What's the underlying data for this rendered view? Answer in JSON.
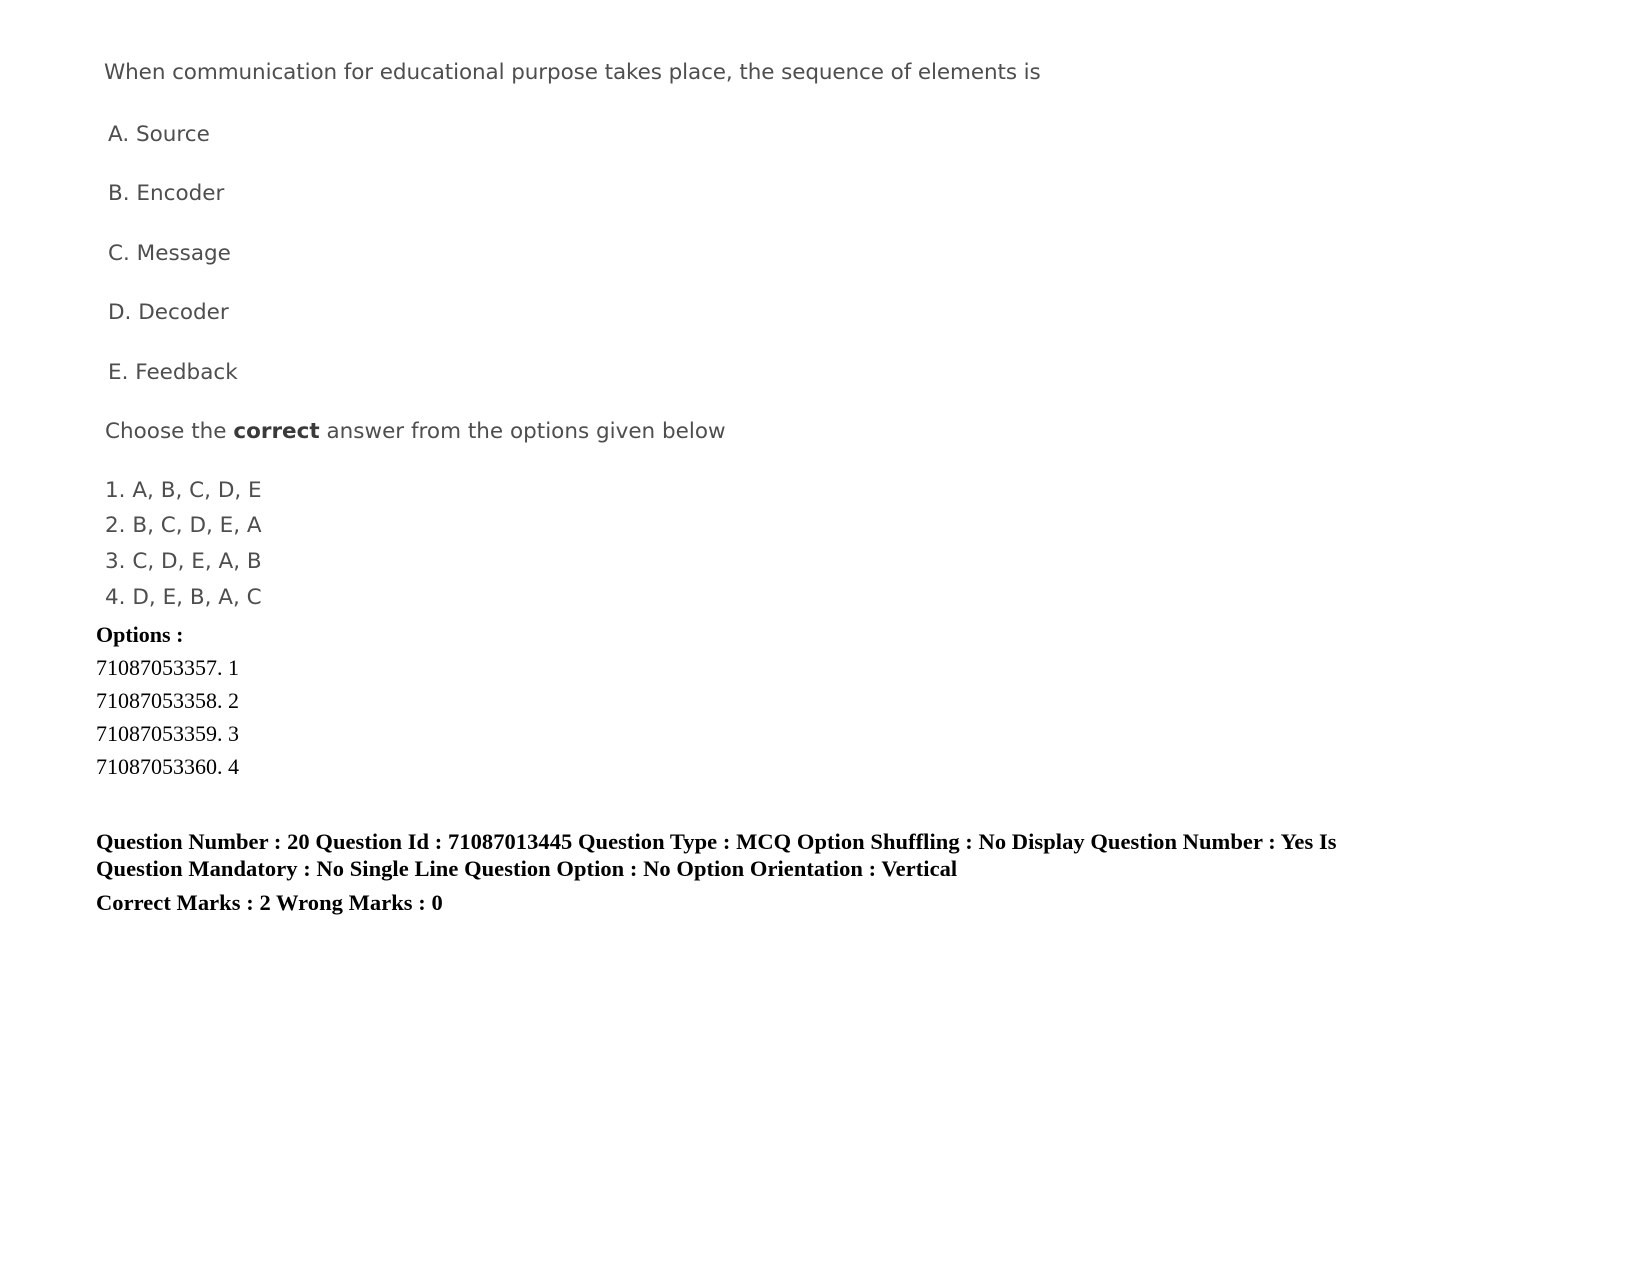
{
  "question": {
    "stem": "When communication for educational purpose takes place, the sequence of elements is",
    "statements": [
      "A. Source",
      "B. Encoder",
      "C. Message",
      "D. Decoder",
      "E. Feedback"
    ],
    "instruction": {
      "before": "Choose the ",
      "emphasis": "correct",
      "after": " answer from the options given below"
    },
    "alternatives": [
      "1. A, B, C, D, E",
      "2. B, C, D, E, A",
      "3. C, D, E, A, B",
      "4. D, E, B, A, C"
    ]
  },
  "options_section": {
    "heading": "Options :",
    "rows": [
      "71087053357. 1",
      "71087053358. 2",
      "71087053359. 3",
      "71087053360. 4"
    ]
  },
  "metadata": {
    "line1": "Question Number : 20 Question Id : 71087013445 Question Type : MCQ Option Shuffling : No Display Question Number : Yes Is Question Mandatory : No Single Line Question Option : No Option Orientation : Vertical",
    "line2": "Correct Marks : 2 Wrong Marks : 0"
  },
  "colors": {
    "page_background": "#ffffff",
    "scanned_text": "#4e4e4e",
    "metadata_text": "#000000"
  }
}
